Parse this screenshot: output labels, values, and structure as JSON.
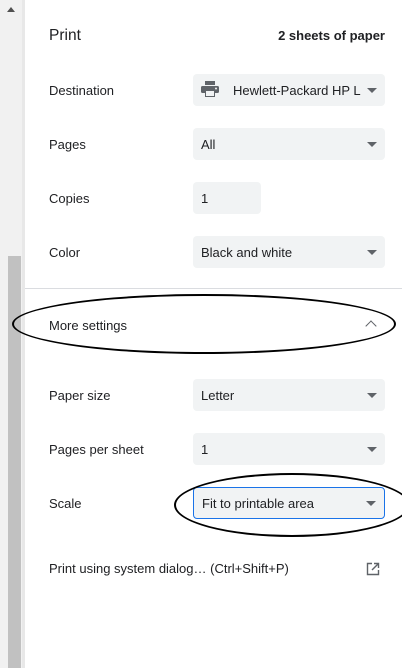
{
  "header": {
    "title": "Print",
    "sheets": "2 sheets of paper"
  },
  "destination": {
    "label": "Destination",
    "value": "Hewlett-Packard HP La",
    "icon": "printer-icon"
  },
  "pages": {
    "label": "Pages",
    "value": "All"
  },
  "copies": {
    "label": "Copies",
    "value": "1"
  },
  "color": {
    "label": "Color",
    "value": "Black and white"
  },
  "more_settings": {
    "label": "More settings",
    "icon": "chevron-up-icon"
  },
  "paper_size": {
    "label": "Paper size",
    "value": "Letter"
  },
  "pages_per_sheet": {
    "label": "Pages per sheet",
    "value": "1"
  },
  "scale": {
    "label": "Scale",
    "value": "Fit to printable area"
  },
  "system_dialog": {
    "label": "Print using system dialog… (Ctrl+Shift+P)",
    "icon": "open-in-new-icon"
  }
}
